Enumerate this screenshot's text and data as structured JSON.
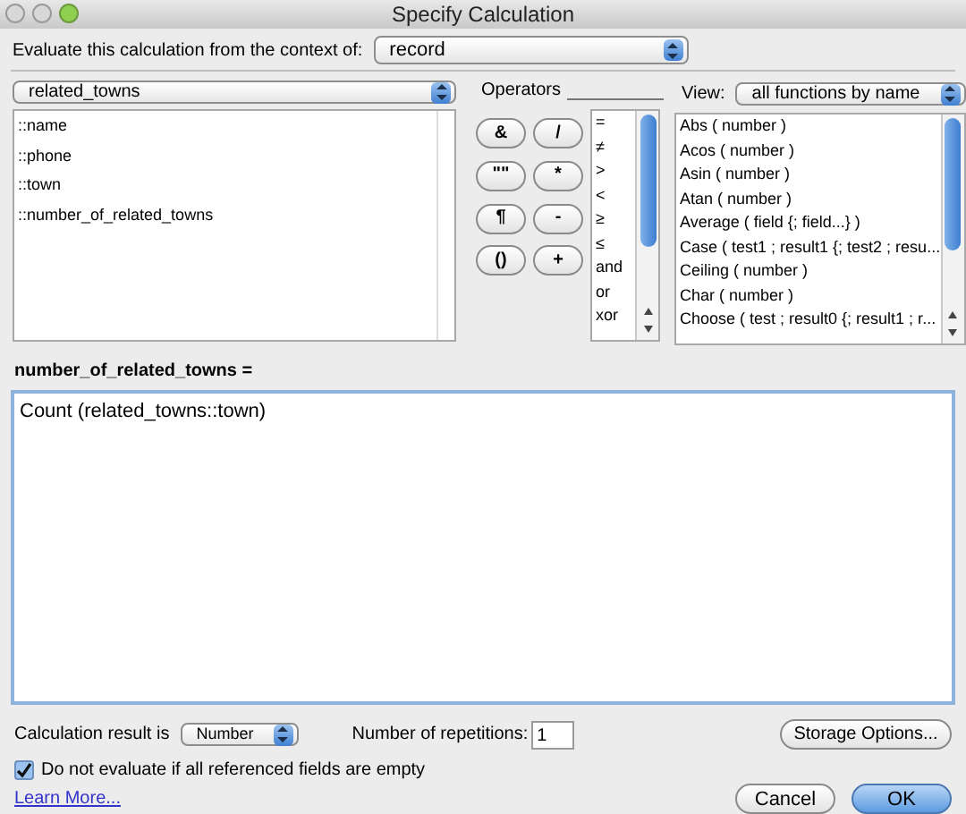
{
  "window": {
    "title": "Specify Calculation"
  },
  "context": {
    "label": "Evaluate this calculation from the context of:",
    "value": "record"
  },
  "table_select": {
    "value": "related_towns"
  },
  "fields": [
    "::name",
    "::phone",
    "::town",
    "::number_of_related_towns"
  ],
  "operators_label": "Operators",
  "operator_buttons": [
    "&",
    "/",
    "\"\"",
    "*",
    "¶",
    "-",
    "()",
    "+"
  ],
  "operators": [
    "=",
    "≠",
    ">",
    "<",
    "≥",
    "≤",
    "and",
    "or",
    "xor"
  ],
  "view": {
    "label": "View:",
    "value": "all functions by name"
  },
  "functions": [
    "Abs ( number )",
    "Acos ( number )",
    "Asin ( number )",
    "Atan ( number )",
    "Average ( field {; field...} )",
    "Case ( test1 ; result1 {; test2 ; resu...",
    "Ceiling ( number )",
    "Char ( number )",
    "Choose ( test ; result0 {; result1 ; r..."
  ],
  "formula_label": "number_of_related_towns =",
  "formula": "Count (related_towns::town)",
  "result": {
    "label": "Calculation result is",
    "value": "Number"
  },
  "repetitions": {
    "label": "Number of repetitions:",
    "value": "1"
  },
  "storage_button": "Storage Options...",
  "do_not_evaluate": {
    "label": "Do not evaluate if all referenced fields are empty",
    "checked": true
  },
  "learn_more": "Learn More...",
  "buttons": [
    {
      "label": "Cancel",
      "kind": "cancel"
    },
    {
      "label": "OK",
      "kind": "default"
    }
  ]
}
